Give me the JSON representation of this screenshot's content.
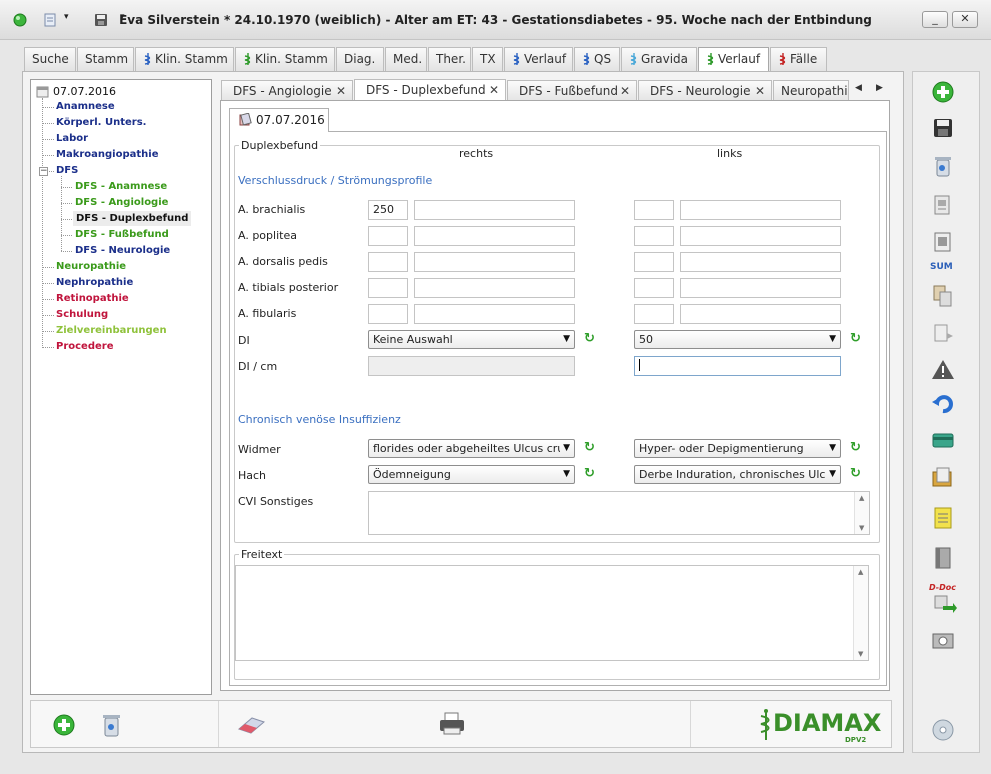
{
  "window": {
    "title": "Eva Silverstein  * 24.10.1970 (weiblich) - Alter am ET: 43 - Gestationsdiabetes - 95. Woche nach der Entbindung",
    "minimize_label": "_",
    "close_label": "✕"
  },
  "main_tabs": [
    {
      "label": "Suche"
    },
    {
      "label": "Stamm"
    },
    {
      "label": "Klin. Stamm"
    },
    {
      "label": "Klin. Stamm"
    },
    {
      "label": "Diag."
    },
    {
      "label": "Med."
    },
    {
      "label": "Ther."
    },
    {
      "label": "TX"
    },
    {
      "label": "Verlauf"
    },
    {
      "label": "QS"
    },
    {
      "label": "Gravida"
    },
    {
      "label": "Verlauf"
    },
    {
      "label": "Fälle"
    }
  ],
  "tree": {
    "root": "07.07.2016",
    "items": [
      {
        "label": "Anamnese",
        "color": "#1b2f8a"
      },
      {
        "label": "Körperl. Unters.",
        "color": "#1b2f8a"
      },
      {
        "label": "Labor",
        "color": "#1b2f8a"
      },
      {
        "label": "Makroangiopathie",
        "color": "#1b2f8a"
      },
      {
        "label": "DFS",
        "color": "#1b2f8a"
      },
      {
        "label": "DFS - Anamnese",
        "color": "#3a9a1a"
      },
      {
        "label": "DFS - Angiologie",
        "color": "#3a9a1a"
      },
      {
        "label": "DFS - Duplexbefund",
        "color": "#111111"
      },
      {
        "label": "DFS - Fußbefund",
        "color": "#3a9a1a"
      },
      {
        "label": "DFS - Neurologie",
        "color": "#1b2f8a"
      },
      {
        "label": "Neuropathie",
        "color": "#3a9a1a"
      },
      {
        "label": "Nephropathie",
        "color": "#1b2f8a"
      },
      {
        "label": "Retinopathie",
        "color": "#c0143c"
      },
      {
        "label": "Schulung",
        "color": "#c0143c"
      },
      {
        "label": "Zielvereinbarungen",
        "color": "#8fc23b"
      },
      {
        "label": "Procedere",
        "color": "#c0143c"
      }
    ],
    "collapse_symbol": "−"
  },
  "doc_tabs": [
    {
      "label": "DFS - Angiologie"
    },
    {
      "label": "DFS - Duplexbefund"
    },
    {
      "label": "DFS - Fußbefund"
    },
    {
      "label": "DFS - Neurologie"
    },
    {
      "label": "Neuropathie"
    }
  ],
  "tab_close": "✕",
  "tab_nav": {
    "prev": "◀",
    "next": "▶"
  },
  "date_tab": "07.07.2016",
  "duplex": {
    "legend": "Duplexbefund",
    "col_right": "rechts",
    "col_left": "links",
    "section1": "Verschlussdruck / Strömungsprofile",
    "rows": [
      {
        "label": "A. brachialis",
        "r_val": "250",
        "r_note": "",
        "l_val": "",
        "l_note": ""
      },
      {
        "label": "A. poplitea",
        "r_val": "",
        "r_note": "",
        "l_val": "",
        "l_note": ""
      },
      {
        "label": "A. dorsalis pedis",
        "r_val": "",
        "r_note": "",
        "l_val": "",
        "l_note": ""
      },
      {
        "label": "A. tibials posterior",
        "r_val": "",
        "r_note": "",
        "l_val": "",
        "l_note": ""
      },
      {
        "label": "A. fibularis",
        "r_val": "",
        "r_note": "",
        "l_val": "",
        "l_note": ""
      }
    ],
    "di_label": "DI",
    "di_right": "Keine Auswahl",
    "di_left": "50",
    "di_cm_label": "DI / cm",
    "di_cm_right": "",
    "di_cm_left": "",
    "section2": "Chronisch venöse Insuffizienz",
    "widmer_label": "Widmer",
    "widmer_right": "florides oder abgeheiltes Ulcus cruris",
    "widmer_left": "Hyper- oder Depigmentierung",
    "hach_label": "Hach",
    "hach_right": "Ödemneigung",
    "hach_left": "Derbe Induration, chronisches Ulcus",
    "cvi_label": "CVI Sonstiges",
    "cvi_value": ""
  },
  "freitext": {
    "legend": "Freitext",
    "value": ""
  },
  "toolbar": {
    "sum_label": "SUM",
    "ddoc_label": "D-Doc"
  },
  "brand": {
    "name": "DIAMAX",
    "sub": "DPV2"
  },
  "glyphs": {
    "refresh": "↻",
    "arrow_down": "▼",
    "sb_up": "▲",
    "sb_down": "▼",
    "caret": "▾"
  },
  "colors": {
    "accent_blue": "#3a6fc0",
    "refresh_green": "#2f9e2a",
    "brand_green": "#3a8f2a"
  }
}
